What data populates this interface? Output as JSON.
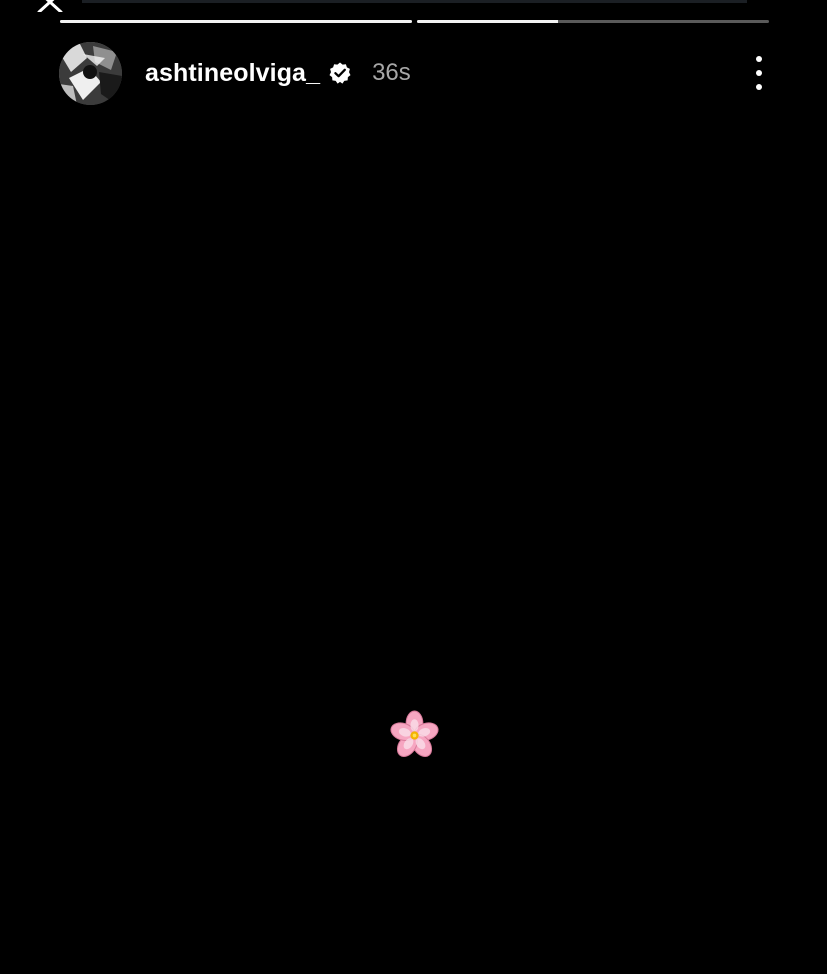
{
  "story": {
    "username": "ashtineolviga_",
    "timestamp": "36s",
    "verified": true,
    "progress_segments": [
      1.0,
      0.4
    ],
    "content_emoji": "cherry-blossom-icon"
  },
  "icons": {
    "close": "close-icon",
    "verified": "verified-badge-icon",
    "more": "more-vertical-icon"
  },
  "colors": {
    "background": "#000000",
    "progress_active": "#f2f2f2",
    "progress_inactive": "#5a5a5a",
    "timestamp": "#a7a7a7",
    "flower_petal": "#f6a6c1",
    "flower_center": "#f3b400"
  }
}
